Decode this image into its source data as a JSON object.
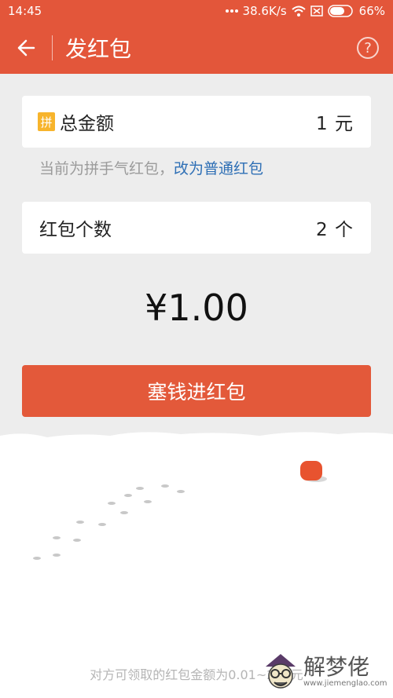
{
  "status": {
    "time": "14:45",
    "network_speed": "38.6K/s",
    "battery": "66%",
    "icons": [
      "signal-dots-icon",
      "wifi-icon",
      "sim-icon",
      "battery-icon"
    ]
  },
  "nav": {
    "title": "发红包",
    "back_icon": "back-arrow-icon",
    "help_label": "?"
  },
  "total": {
    "badge": "拼",
    "label": "总金额",
    "value": "1 元"
  },
  "hint": {
    "text": "当前为拼手气红包，",
    "link": "改为普通红包"
  },
  "count": {
    "label": "红包个数",
    "value": "2 个"
  },
  "amount": "¥1.00",
  "submit_label": "塞钱进红包",
  "footer_note": "对方可领取的红包金额为0.01~200元",
  "watermark": {
    "title": "解梦佬",
    "url": "www.jiemenglao.com"
  },
  "colors": {
    "brand": "#e3563a",
    "button": "#e3593a",
    "link": "#2e6fb5",
    "background": "#ededed"
  }
}
